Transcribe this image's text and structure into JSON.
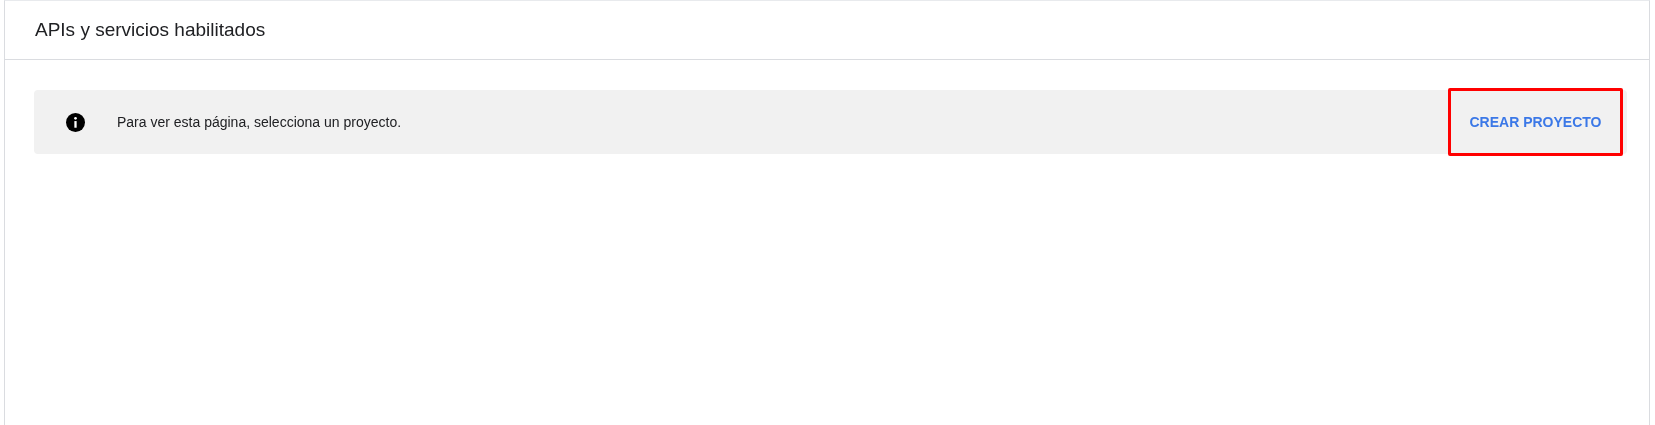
{
  "header": {
    "title": "APIs y servicios habilitados"
  },
  "notice": {
    "message": "Para ver esta página, selecciona un proyecto.",
    "action": {
      "label": "CREAR PROYECTO",
      "highlighted": true
    }
  }
}
